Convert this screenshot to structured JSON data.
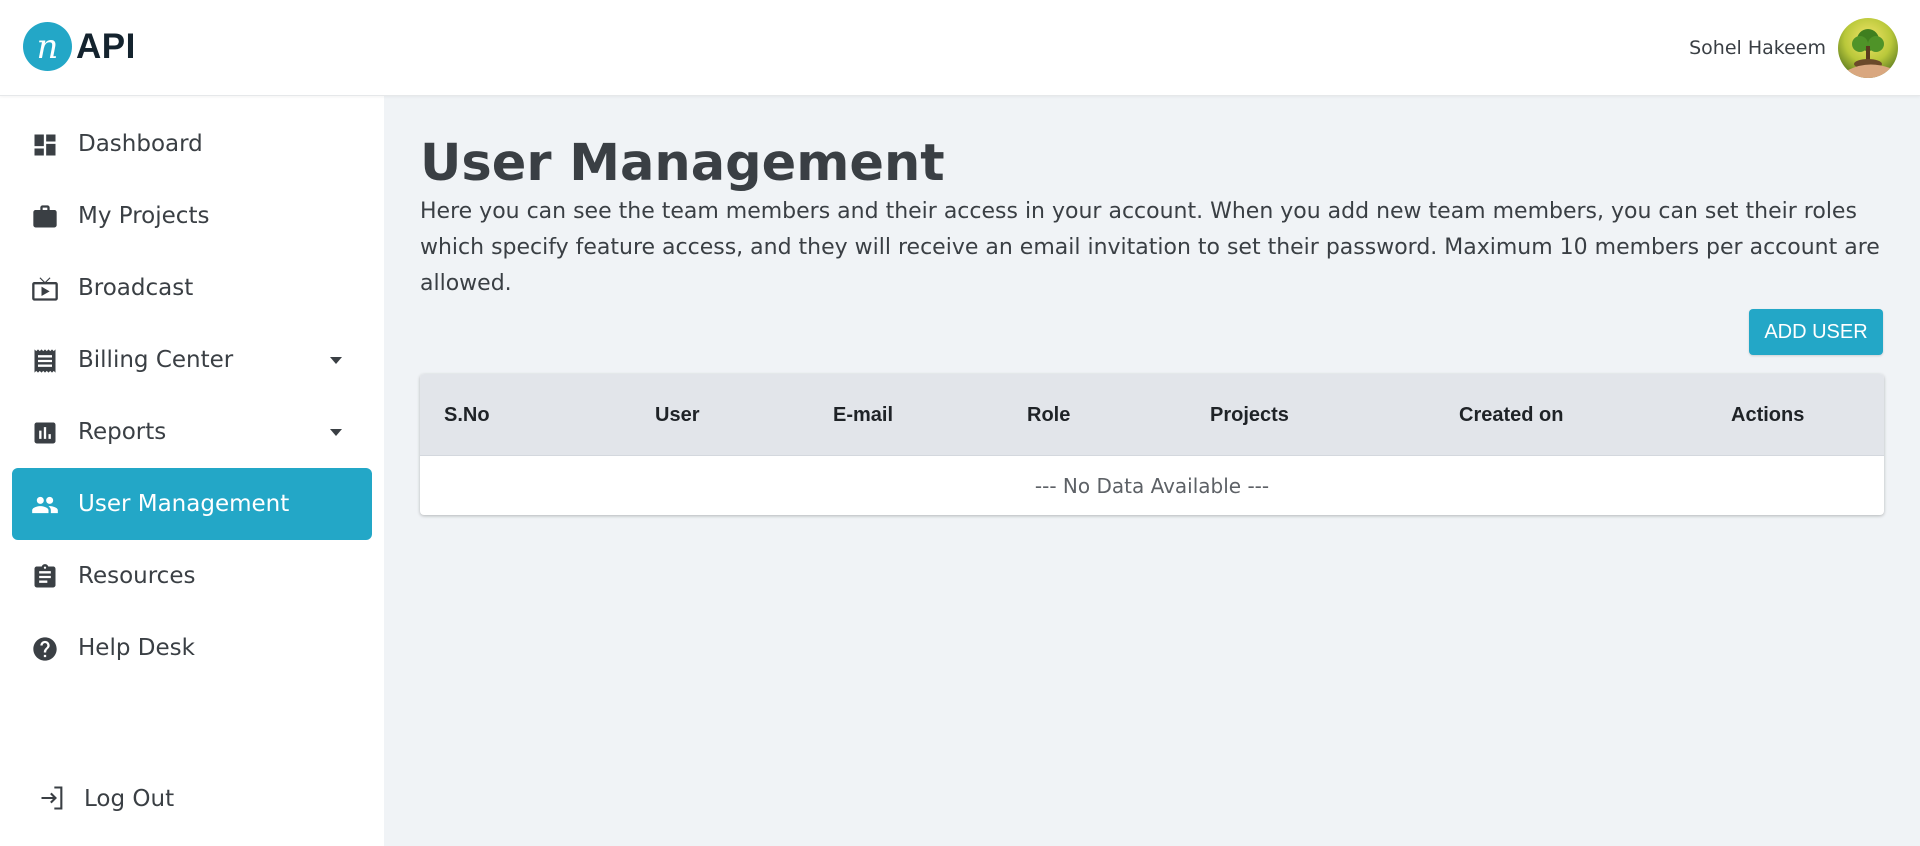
{
  "app": {
    "logo_text": "API",
    "logo_mark": "n"
  },
  "header": {
    "user_name": "Sohel Hakeem",
    "avatar": "tree-avatar"
  },
  "sidebar": {
    "items": [
      {
        "label": "Dashboard",
        "icon": "dashboard-icon",
        "active": false,
        "has_dropdown": false
      },
      {
        "label": "My Projects",
        "icon": "briefcase-icon",
        "active": false,
        "has_dropdown": false
      },
      {
        "label": "Broadcast",
        "icon": "tv-icon",
        "active": false,
        "has_dropdown": false
      },
      {
        "label": "Billing Center",
        "icon": "receipt-icon",
        "active": false,
        "has_dropdown": true
      },
      {
        "label": "Reports",
        "icon": "bar-chart-icon",
        "active": false,
        "has_dropdown": true
      },
      {
        "label": "User Management",
        "icon": "people-icon",
        "active": true,
        "has_dropdown": false
      },
      {
        "label": "Resources",
        "icon": "clipboard-icon",
        "active": false,
        "has_dropdown": false
      },
      {
        "label": "Help Desk",
        "icon": "help-icon",
        "active": false,
        "has_dropdown": false
      }
    ],
    "logout": {
      "label": "Log Out",
      "icon": "logout-icon"
    }
  },
  "main": {
    "title": "User Management",
    "description": "Here you can see the team members and their access in your account. When you add new team members, you can set their roles which specify feature access, and they will receive an email invitation to set their password. Maximum 10 members per account are allowed.",
    "add_button": "ADD USER",
    "table": {
      "columns": [
        "S.No",
        "User",
        "E-mail",
        "Role",
        "Projects",
        "Created on",
        "Actions"
      ],
      "empty_message": "--- No Data Available ---"
    }
  },
  "colors": {
    "accent": "#23a7c7",
    "text": "#3a3f44",
    "content_bg": "#f0f3f6",
    "table_header_bg": "#e2e5ea"
  }
}
